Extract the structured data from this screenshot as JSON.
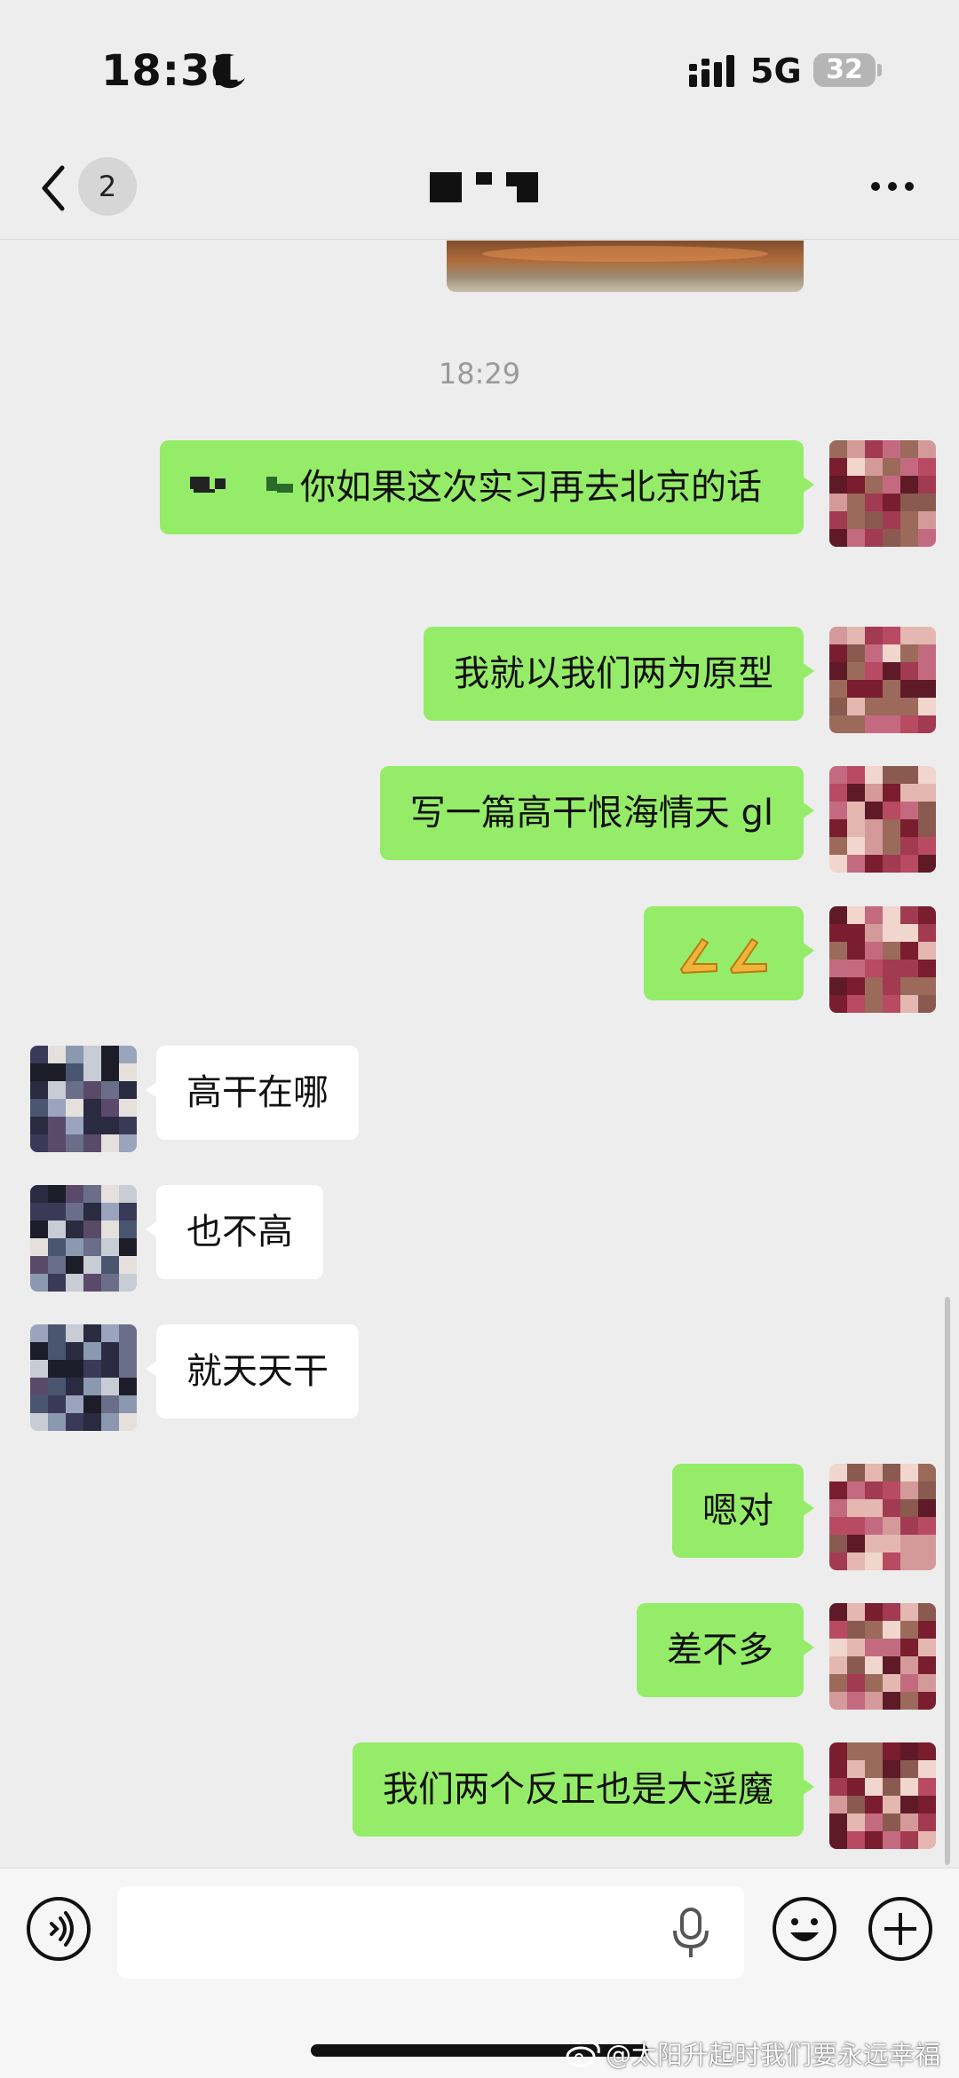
{
  "status_bar": {
    "time": "18:31",
    "network": "5G",
    "battery": "32"
  },
  "header": {
    "unread_count": "2"
  },
  "chat": {
    "timestamp": "18:29",
    "messages": [
      {
        "side": "me",
        "text": "你如果这次实习再去北京的话"
      },
      {
        "side": "me",
        "text": "我就以我们两为原型"
      },
      {
        "side": "me",
        "text": "写一篇高干恨海情天 gl"
      },
      {
        "side": "me",
        "text": "🙏🙏"
      },
      {
        "side": "peer",
        "text": "高干在哪"
      },
      {
        "side": "peer",
        "text": "也不高"
      },
      {
        "side": "peer",
        "text": "就天天干"
      },
      {
        "side": "me",
        "text": "嗯对"
      },
      {
        "side": "me",
        "text": "差不多"
      },
      {
        "side": "me",
        "text": "我们两个反正也是大淫魔"
      }
    ]
  },
  "input_bar": {
    "value": ""
  },
  "watermark": "@太阳升起时我们要永远幸福",
  "colors": {
    "background": "#ededed",
    "my_bubble": "#95ec69",
    "peer_bubble": "#ffffff",
    "timestamp": "#9a9a9a"
  }
}
